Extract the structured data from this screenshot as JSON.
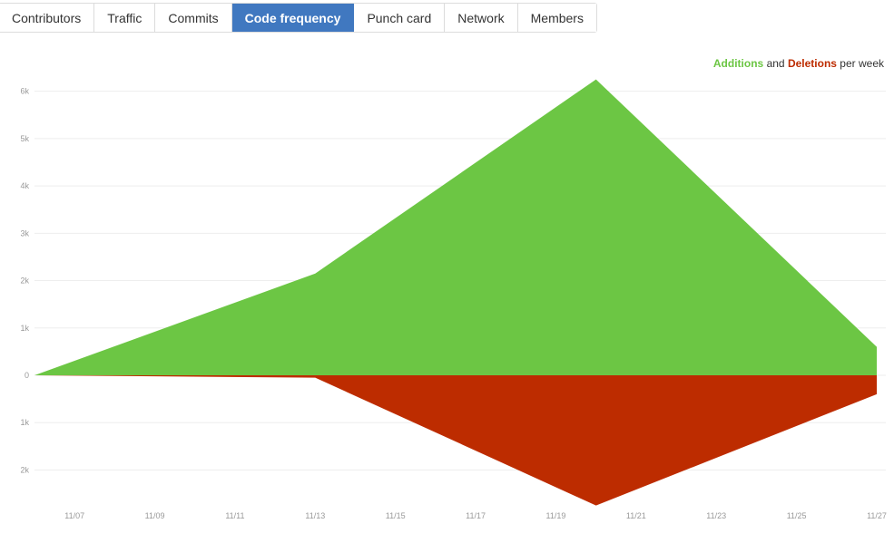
{
  "tabs": [
    {
      "label": "Contributors",
      "selected": false
    },
    {
      "label": "Traffic",
      "selected": false
    },
    {
      "label": "Commits",
      "selected": false
    },
    {
      "label": "Code frequency",
      "selected": true
    },
    {
      "label": "Punch card",
      "selected": false
    },
    {
      "label": "Network",
      "selected": false
    },
    {
      "label": "Members",
      "selected": false
    }
  ],
  "legend": {
    "additions": "Additions",
    "and": "and",
    "deletions": "Deletions",
    "suffix": "per week"
  },
  "colors": {
    "additions": "#6cc644",
    "deletions": "#bd2c00",
    "selected_tab": "#4078c0",
    "grid": "#eeeeee",
    "axis_text": "#999999"
  },
  "chart_data": {
    "type": "area",
    "title": "",
    "xlabel": "",
    "ylabel": "",
    "y_tick_labels": [
      {
        "value": 6000,
        "label": "6k"
      },
      {
        "value": 5000,
        "label": "5k"
      },
      {
        "value": 4000,
        "label": "4k"
      },
      {
        "value": 3000,
        "label": "3k"
      },
      {
        "value": 2000,
        "label": "2k"
      },
      {
        "value": 1000,
        "label": "1k"
      },
      {
        "value": 0,
        "label": "0"
      },
      {
        "value": -1000,
        "label": "1k"
      },
      {
        "value": -2000,
        "label": "2k"
      }
    ],
    "ylim": [
      -2700,
      6300
    ],
    "x_tick_labels": [
      "11/07",
      "11/09",
      "11/11",
      "11/13",
      "11/15",
      "11/17",
      "11/19",
      "11/21",
      "11/23",
      "11/25",
      "11/27"
    ],
    "x_tick_dates": [
      "2016-11-07",
      "2016-11-09",
      "2016-11-11",
      "2016-11-13",
      "2016-11-15",
      "2016-11-17",
      "2016-11-19",
      "2016-11-21",
      "2016-11-23",
      "2016-11-25",
      "2016-11-27"
    ],
    "x": [
      "2016-11-06",
      "2016-11-13",
      "2016-11-20",
      "2016-11-27"
    ],
    "xlim": [
      "2016-11-06",
      "2016-11-27"
    ],
    "series": [
      {
        "name": "Additions",
        "values": [
          0,
          2150,
          6250,
          600
        ]
      },
      {
        "name": "Deletions",
        "values": [
          0,
          -50,
          -2750,
          -400
        ]
      }
    ],
    "grid": true
  }
}
